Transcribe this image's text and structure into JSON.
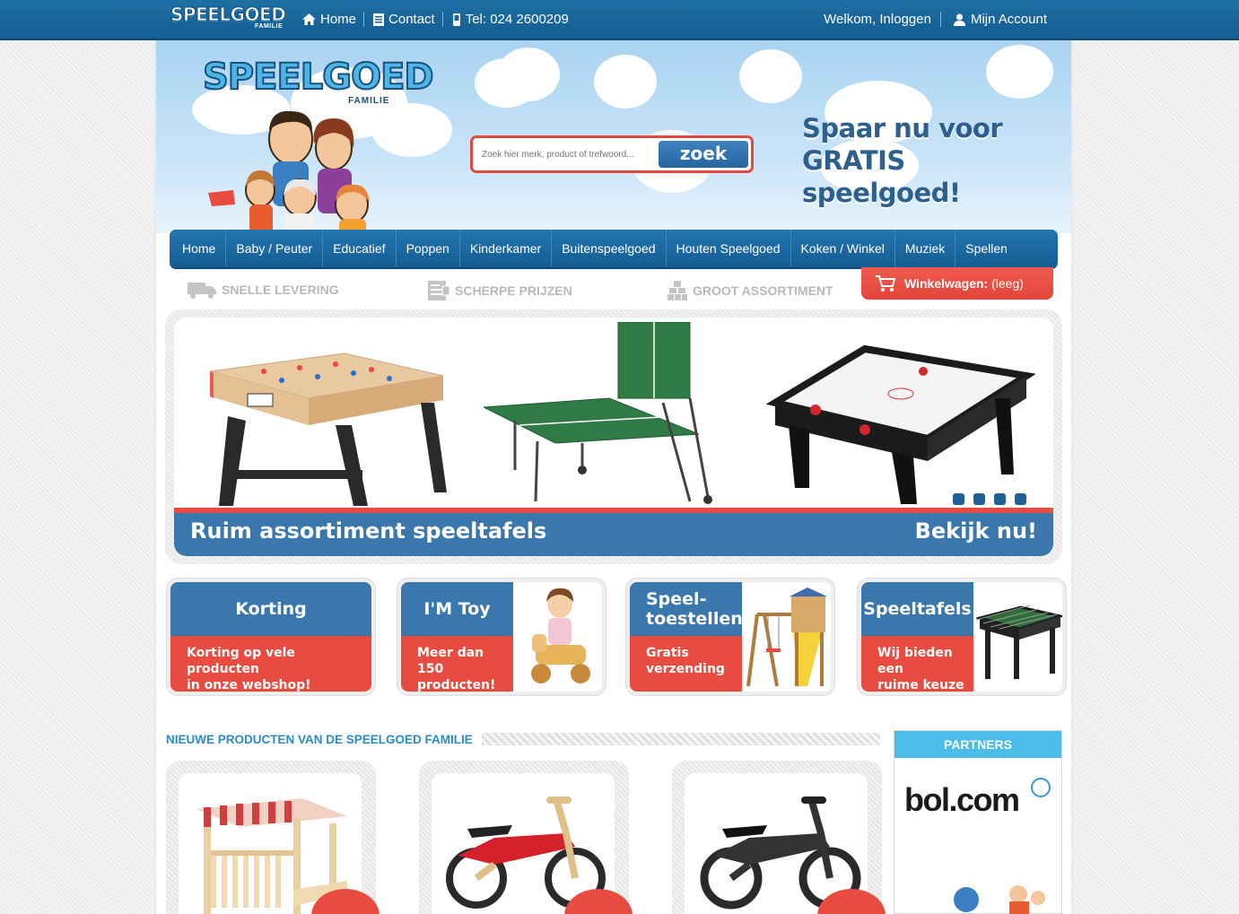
{
  "topbar": {
    "logo_text": "SPEELGOED",
    "logo_sub": "FAMILIE",
    "home": "Home",
    "contact": "Contact",
    "phone": "Tel: 024 2600209",
    "welcome": "Welkom, Inloggen",
    "account": "Mijn Account"
  },
  "header": {
    "logo_text": "SPEELGOED",
    "logo_sub": "FAMILIE",
    "search_placeholder": "Zoek hier merk, product of trefwoord...",
    "search_button": "zoek",
    "promo_line1": "Spaar nu voor",
    "promo_line2": "GRATIS speelgoed!"
  },
  "nav": {
    "items": [
      "Home",
      "Baby / Peuter",
      "Educatief",
      "Poppen",
      "Kinderkamer",
      "Buitenspeelgoed",
      "Houten Speelgoed",
      "Koken / Winkel",
      "Muziek",
      "Spellen"
    ]
  },
  "features": {
    "delivery": "SNELLE LEVERING",
    "prices": "SCHERPE PRIJZEN",
    "assortment": "GROOT ASSORTIMENT"
  },
  "cart": {
    "label": "Winkelwagen:",
    "status": "(leeg)"
  },
  "slider": {
    "caption": "Ruim assortiment speeltafels",
    "cta": "Bekijk nu!",
    "active_dot": 1,
    "dot_count": 4
  },
  "banners": [
    {
      "title": "Korting",
      "text1": "Korting op vele producten",
      "text2": "in onze webshop!"
    },
    {
      "title": "I'M Toy",
      "text1": "Meer dan 150",
      "text2": "producten!"
    },
    {
      "title1": "Speel-",
      "title2": "toestellen",
      "text1": "Gratis",
      "text2": "verzending"
    },
    {
      "title": "Speeltafels",
      "text1": "Wij bieden een",
      "text2": "ruime keuze"
    }
  ],
  "new_products": {
    "title": "NIEUWE PRODUCTEN VAN DE SPEELGOED FAMILIE"
  },
  "partners": {
    "title": "PARTNERS",
    "bol": "bol.com"
  },
  "colors": {
    "primary_blue": "#1f6fa6",
    "accent_red": "#e84b3f",
    "light_blue": "#4cbde9"
  }
}
